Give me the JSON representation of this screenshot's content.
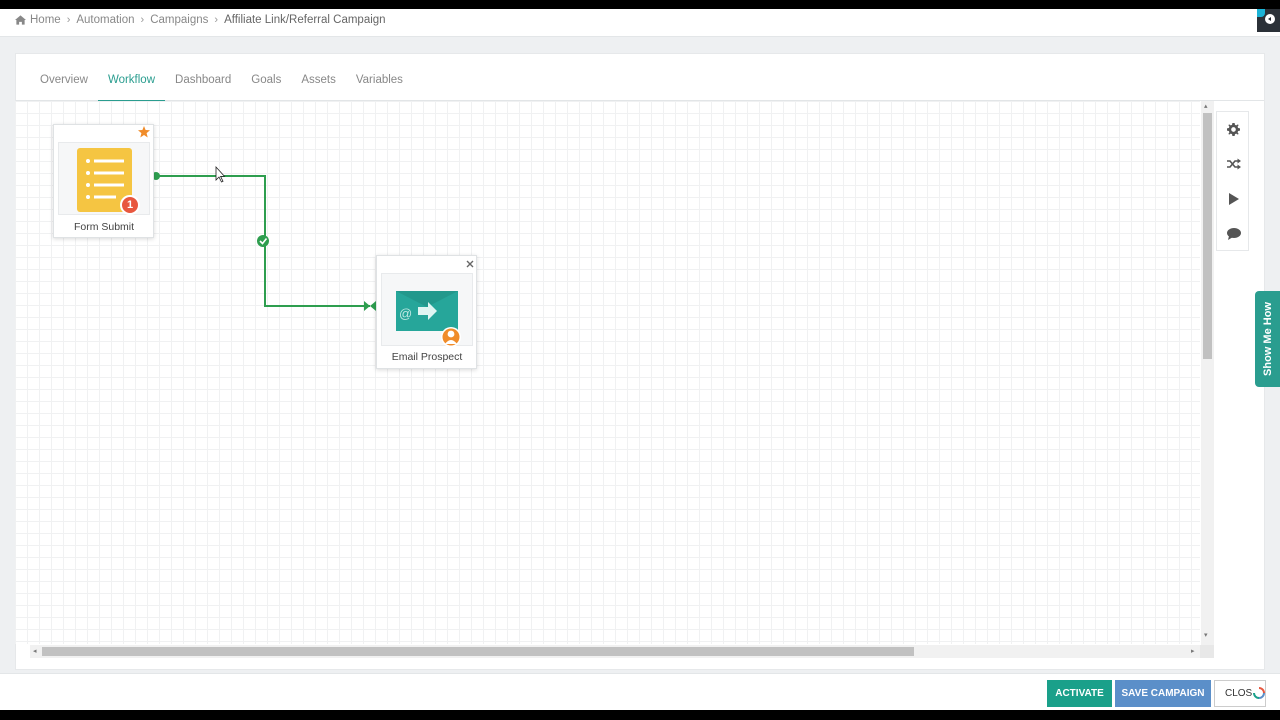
{
  "breadcrumb": {
    "items": [
      "Home",
      "Automation",
      "Campaigns"
    ],
    "current": "Affiliate Link/Referral Campaign"
  },
  "tabs": [
    "Overview",
    "Workflow",
    "Dashboard",
    "Goals",
    "Assets",
    "Variables"
  ],
  "active_tab": "Workflow",
  "nodes": {
    "form_submit": {
      "label": "Form Submit",
      "badge": "1",
      "icon": "form-list-icon"
    },
    "email_prospect": {
      "label": "Email Prospect",
      "icon": "email-send-icon"
    }
  },
  "toolbar": {
    "icons": [
      "gear-icon",
      "shuffle-icon",
      "play-icon",
      "comment-icon"
    ]
  },
  "help": {
    "show_me_how": "Show Me How"
  },
  "footer": {
    "activate": "ACTIVATE",
    "save_campaign": "SAVE CAMPAIGN",
    "close": "CLOS"
  },
  "colors": {
    "accent": "#2a9d8f",
    "connector": "#2e9e4f",
    "form_icon": "#f5c542",
    "email_icon": "#26a69a",
    "badge": "#e8573f",
    "star": "#f08c2a",
    "save_button": "#5b8fc9"
  }
}
